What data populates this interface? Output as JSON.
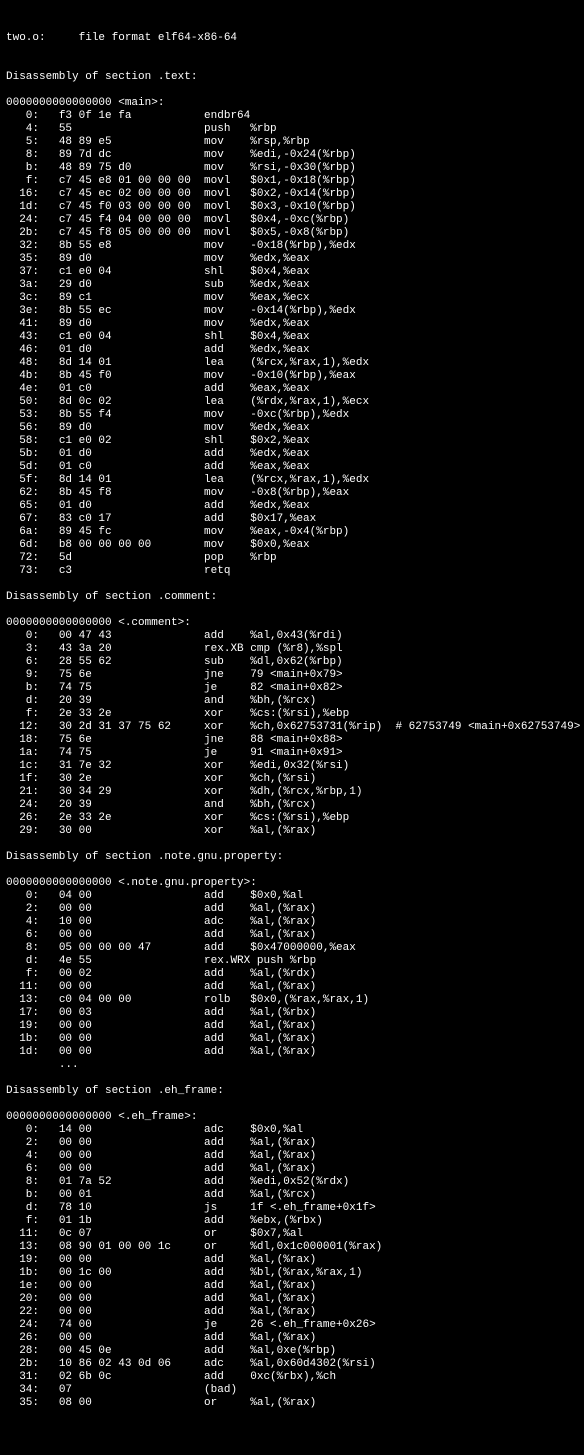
{
  "header": "two.o:     file format elf64-x86-64",
  "sections": [
    {
      "title": "Disassembly of section .text:",
      "symbol": "0000000000000000 <main>:",
      "lines": [
        {
          "o": "0",
          "b": "f3 0f 1e fa",
          "m": "endbr64",
          "a": ""
        },
        {
          "o": "4",
          "b": "55",
          "m": "push",
          "a": "%rbp"
        },
        {
          "o": "5",
          "b": "48 89 e5",
          "m": "mov",
          "a": "%rsp,%rbp"
        },
        {
          "o": "8",
          "b": "89 7d dc",
          "m": "mov",
          "a": "%edi,-0x24(%rbp)"
        },
        {
          "o": "b",
          "b": "48 89 75 d0",
          "m": "mov",
          "a": "%rsi,-0x30(%rbp)"
        },
        {
          "o": "f",
          "b": "c7 45 e8 01 00 00 00",
          "m": "movl",
          "a": "$0x1,-0x18(%rbp)"
        },
        {
          "o": "16",
          "b": "c7 45 ec 02 00 00 00",
          "m": "movl",
          "a": "$0x2,-0x14(%rbp)"
        },
        {
          "o": "1d",
          "b": "c7 45 f0 03 00 00 00",
          "m": "movl",
          "a": "$0x3,-0x10(%rbp)"
        },
        {
          "o": "24",
          "b": "c7 45 f4 04 00 00 00",
          "m": "movl",
          "a": "$0x4,-0xc(%rbp)"
        },
        {
          "o": "2b",
          "b": "c7 45 f8 05 00 00 00",
          "m": "movl",
          "a": "$0x5,-0x8(%rbp)"
        },
        {
          "o": "32",
          "b": "8b 55 e8",
          "m": "mov",
          "a": "-0x18(%rbp),%edx"
        },
        {
          "o": "35",
          "b": "89 d0",
          "m": "mov",
          "a": "%edx,%eax"
        },
        {
          "o": "37",
          "b": "c1 e0 04",
          "m": "shl",
          "a": "$0x4,%eax"
        },
        {
          "o": "3a",
          "b": "29 d0",
          "m": "sub",
          "a": "%edx,%eax"
        },
        {
          "o": "3c",
          "b": "89 c1",
          "m": "mov",
          "a": "%eax,%ecx"
        },
        {
          "o": "3e",
          "b": "8b 55 ec",
          "m": "mov",
          "a": "-0x14(%rbp),%edx"
        },
        {
          "o": "41",
          "b": "89 d0",
          "m": "mov",
          "a": "%edx,%eax"
        },
        {
          "o": "43",
          "b": "c1 e0 04",
          "m": "shl",
          "a": "$0x4,%eax"
        },
        {
          "o": "46",
          "b": "01 d0",
          "m": "add",
          "a": "%edx,%eax"
        },
        {
          "o": "48",
          "b": "8d 14 01",
          "m": "lea",
          "a": "(%rcx,%rax,1),%edx"
        },
        {
          "o": "4b",
          "b": "8b 45 f0",
          "m": "mov",
          "a": "-0x10(%rbp),%eax"
        },
        {
          "o": "4e",
          "b": "01 c0",
          "m": "add",
          "a": "%eax,%eax"
        },
        {
          "o": "50",
          "b": "8d 0c 02",
          "m": "lea",
          "a": "(%rdx,%rax,1),%ecx"
        },
        {
          "o": "53",
          "b": "8b 55 f4",
          "m": "mov",
          "a": "-0xc(%rbp),%edx"
        },
        {
          "o": "56",
          "b": "89 d0",
          "m": "mov",
          "a": "%edx,%eax"
        },
        {
          "o": "58",
          "b": "c1 e0 02",
          "m": "shl",
          "a": "$0x2,%eax"
        },
        {
          "o": "5b",
          "b": "01 d0",
          "m": "add",
          "a": "%edx,%eax"
        },
        {
          "o": "5d",
          "b": "01 c0",
          "m": "add",
          "a": "%eax,%eax"
        },
        {
          "o": "5f",
          "b": "8d 14 01",
          "m": "lea",
          "a": "(%rcx,%rax,1),%edx"
        },
        {
          "o": "62",
          "b": "8b 45 f8",
          "m": "mov",
          "a": "-0x8(%rbp),%eax"
        },
        {
          "o": "65",
          "b": "01 d0",
          "m": "add",
          "a": "%edx,%eax"
        },
        {
          "o": "67",
          "b": "83 c0 17",
          "m": "add",
          "a": "$0x17,%eax"
        },
        {
          "o": "6a",
          "b": "89 45 fc",
          "m": "mov",
          "a": "%eax,-0x4(%rbp)"
        },
        {
          "o": "6d",
          "b": "b8 00 00 00 00",
          "m": "mov",
          "a": "$0x0,%eax"
        },
        {
          "o": "72",
          "b": "5d",
          "m": "pop",
          "a": "%rbp"
        },
        {
          "o": "73",
          "b": "c3",
          "m": "retq",
          "a": ""
        }
      ]
    },
    {
      "title": "Disassembly of section .comment:",
      "symbol": "0000000000000000 <.comment>:",
      "lines": [
        {
          "o": "0",
          "b": "00 47 43",
          "m": "add",
          "a": "%al,0x43(%rdi)"
        },
        {
          "o": "3",
          "b": "43 3a 20",
          "m": "rex.XB",
          "a": "cmp (%r8),%spl",
          "noPad": true
        },
        {
          "o": "6",
          "b": "28 55 62",
          "m": "sub",
          "a": "%dl,0x62(%rbp)"
        },
        {
          "o": "9",
          "b": "75 6e",
          "m": "jne",
          "a": "79 <main+0x79>"
        },
        {
          "o": "b",
          "b": "74 75",
          "m": "je",
          "a": "82 <main+0x82>"
        },
        {
          "o": "d",
          "b": "20 39",
          "m": "and",
          "a": "%bh,(%rcx)"
        },
        {
          "o": "f",
          "b": "2e 33 2e",
          "m": "xor",
          "a": "%cs:(%rsi),%ebp"
        },
        {
          "o": "12",
          "b": "30 2d 31 37 75 62",
          "m": "xor",
          "a": "%ch,0x62753731(%rip)",
          "c": "# 62753749 <main+0x62753749>"
        },
        {
          "o": "18",
          "b": "75 6e",
          "m": "jne",
          "a": "88 <main+0x88>"
        },
        {
          "o": "1a",
          "b": "74 75",
          "m": "je",
          "a": "91 <main+0x91>"
        },
        {
          "o": "1c",
          "b": "31 7e 32",
          "m": "xor",
          "a": "%edi,0x32(%rsi)"
        },
        {
          "o": "1f",
          "b": "30 2e",
          "m": "xor",
          "a": "%ch,(%rsi)"
        },
        {
          "o": "21",
          "b": "30 34 29",
          "m": "xor",
          "a": "%dh,(%rcx,%rbp,1)"
        },
        {
          "o": "24",
          "b": "20 39",
          "m": "and",
          "a": "%bh,(%rcx)"
        },
        {
          "o": "26",
          "b": "2e 33 2e",
          "m": "xor",
          "a": "%cs:(%rsi),%ebp"
        },
        {
          "o": "29",
          "b": "30 00",
          "m": "xor",
          "a": "%al,(%rax)"
        }
      ]
    },
    {
      "title": "Disassembly of section .note.gnu.property:",
      "symbol": "0000000000000000 <.note.gnu.property>:",
      "lines": [
        {
          "o": "0",
          "b": "04 00",
          "m": "add",
          "a": "$0x0,%al"
        },
        {
          "o": "2",
          "b": "00 00",
          "m": "add",
          "a": "%al,(%rax)"
        },
        {
          "o": "4",
          "b": "10 00",
          "m": "adc",
          "a": "%al,(%rax)"
        },
        {
          "o": "6",
          "b": "00 00",
          "m": "add",
          "a": "%al,(%rax)"
        },
        {
          "o": "8",
          "b": "05 00 00 00 47",
          "m": "add",
          "a": "$0x47000000,%eax"
        },
        {
          "o": "d",
          "b": "4e 55",
          "m": "rex.WRX",
          "a": "push %rbp",
          "noPad": true
        },
        {
          "o": "f",
          "b": "00 02",
          "m": "add",
          "a": "%al,(%rdx)"
        },
        {
          "o": "11",
          "b": "00 00",
          "m": "add",
          "a": "%al,(%rax)"
        },
        {
          "o": "13",
          "b": "c0 04 00 00",
          "m": "rolb",
          "a": "$0x0,(%rax,%rax,1)"
        },
        {
          "o": "17",
          "b": "00 03",
          "m": "add",
          "a": "%al,(%rbx)"
        },
        {
          "o": "19",
          "b": "00 00",
          "m": "add",
          "a": "%al,(%rax)"
        },
        {
          "o": "1b",
          "b": "00 00",
          "m": "add",
          "a": "%al,(%rax)"
        },
        {
          "o": "1d",
          "b": "00 00",
          "m": "add",
          "a": "%al,(%rax)"
        }
      ],
      "trailer": "\t..."
    },
    {
      "title": "Disassembly of section .eh_frame:",
      "symbol": "0000000000000000 <.eh_frame>:",
      "lines": [
        {
          "o": "0",
          "b": "14 00",
          "m": "adc",
          "a": "$0x0,%al"
        },
        {
          "o": "2",
          "b": "00 00",
          "m": "add",
          "a": "%al,(%rax)"
        },
        {
          "o": "4",
          "b": "00 00",
          "m": "add",
          "a": "%al,(%rax)"
        },
        {
          "o": "6",
          "b": "00 00",
          "m": "add",
          "a": "%al,(%rax)"
        },
        {
          "o": "8",
          "b": "01 7a 52",
          "m": "add",
          "a": "%edi,0x52(%rdx)"
        },
        {
          "o": "b",
          "b": "00 01",
          "m": "add",
          "a": "%al,(%rcx)"
        },
        {
          "o": "d",
          "b": "78 10",
          "m": "js",
          "a": "1f <.eh_frame+0x1f>"
        },
        {
          "o": "f",
          "b": "01 1b",
          "m": "add",
          "a": "%ebx,(%rbx)"
        },
        {
          "o": "11",
          "b": "0c 07",
          "m": "or",
          "a": "$0x7,%al"
        },
        {
          "o": "13",
          "b": "08 90 01 00 00 1c",
          "m": "or",
          "a": "%dl,0x1c000001(%rax)"
        },
        {
          "o": "19",
          "b": "00 00",
          "m": "add",
          "a": "%al,(%rax)"
        },
        {
          "o": "1b",
          "b": "00 1c 00",
          "m": "add",
          "a": "%bl,(%rax,%rax,1)"
        },
        {
          "o": "1e",
          "b": "00 00",
          "m": "add",
          "a": "%al,(%rax)"
        },
        {
          "o": "20",
          "b": "00 00",
          "m": "add",
          "a": "%al,(%rax)"
        },
        {
          "o": "22",
          "b": "00 00",
          "m": "add",
          "a": "%al,(%rax)"
        },
        {
          "o": "24",
          "b": "74 00",
          "m": "je",
          "a": "26 <.eh_frame+0x26>"
        },
        {
          "o": "26",
          "b": "00 00",
          "m": "add",
          "a": "%al,(%rax)"
        },
        {
          "o": "28",
          "b": "00 45 0e",
          "m": "add",
          "a": "%al,0xe(%rbp)"
        },
        {
          "o": "2b",
          "b": "10 86 02 43 0d 06",
          "m": "adc",
          "a": "%al,0x60d4302(%rsi)"
        },
        {
          "o": "31",
          "b": "02 6b 0c",
          "m": "add",
          "a": "0xc(%rbx),%ch"
        },
        {
          "o": "34",
          "b": "07",
          "m": "(bad)",
          "a": ""
        },
        {
          "o": "35",
          "b": "08 00",
          "m": "or",
          "a": "%al,(%rax)"
        }
      ]
    }
  ]
}
